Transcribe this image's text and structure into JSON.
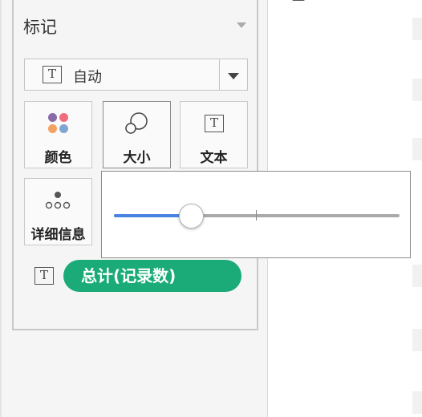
{
  "marks_panel": {
    "title": "标记",
    "mark_type": {
      "icon": "text-icon",
      "label": "自动"
    },
    "cards": [
      {
        "id": "color",
        "label": "颜色",
        "icon": "color-dots-icon"
      },
      {
        "id": "size",
        "label": "大小",
        "icon": "size-circles-icon"
      },
      {
        "id": "text",
        "label": "文本",
        "icon": "text-icon"
      },
      {
        "id": "detail",
        "label": "详细信息",
        "icon": "detail-dots-icon"
      }
    ],
    "field": {
      "icon": "text-icon",
      "label": "总计(记录数)"
    }
  },
  "icons": {
    "text_glyph": "T"
  },
  "size_popup": {
    "slider_value": 0.27
  },
  "colors": {
    "pill": "#1aab78",
    "slider_fill": "#4a84e3",
    "dot_purple": "#8a6aa7",
    "dot_pink": "#f16b7d",
    "dot_orange": "#f3a261",
    "dot_blue": "#7fa6d3"
  }
}
